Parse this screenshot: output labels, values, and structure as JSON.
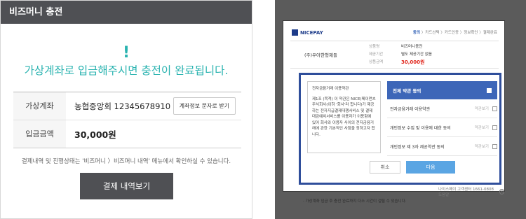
{
  "left": {
    "header_title": "비즈머니 충전",
    "exclamation": "!",
    "headline": "가상계좌로 입금해주시면 충전이 완료됩니다.",
    "rows": [
      {
        "label": "가상계좌",
        "value": "농협중앙회 12345678910",
        "button": "계좌정보 문자로 받기"
      },
      {
        "label": "입금금액",
        "value": "30,000원"
      }
    ],
    "notice": "결제내역 및 진행상태는 '비즈머니 〉비즈머니 내역' 메뉴에서 확인하실 수 있습니다.",
    "history_button": "결제 내역보기"
  },
  "right": {
    "logo_text": "NICEPAY",
    "steps": {
      "current": "동의",
      "rest": " 〉카드선택 〉카드인증 〉정보확인 〉결제완료"
    },
    "merchant": "(주)우아한형제들",
    "product_label": "상품명",
    "product_value": "비즈머니충전",
    "period_label": "제공기간",
    "period_value": "별도 제공기간 없음",
    "amount_label": "상품금액",
    "amount_value": "30,000원",
    "terms_title": "전자금융거래 이용약관",
    "terms_body": "제1조 (목적) 이 약관은 NICE(페이먼츠 주식회사(이하 '회사'라 합니다)가 제공하는 전자지급결제대행서비스 및 결제대금예치서비스를 이용자가 이용함에 있어 회사와 이용자 사이의 전자금융거래에 관한 기본적인 사항을 정하고자 합니다.",
    "agree_all": "전체 약관 동의",
    "agree_items": [
      {
        "label": "전자금융거래 이용약관",
        "view": "약관보기"
      },
      {
        "label": "개인정보 수집 및 이용에 대한 동의",
        "view": "약관보기"
      },
      {
        "label": "개인정보 제 3자 제공약관 동의",
        "view": "약관보기"
      }
    ],
    "cancel": "취소",
    "next": "다음",
    "footer": "나이스페이 고객센터 1661-0808 도움말",
    "bottom1": "· 가상계좌 입금 후 충전 완료까지 다소 시간이 걸릴 수 있습니다.",
    "bottom2": ""
  }
}
